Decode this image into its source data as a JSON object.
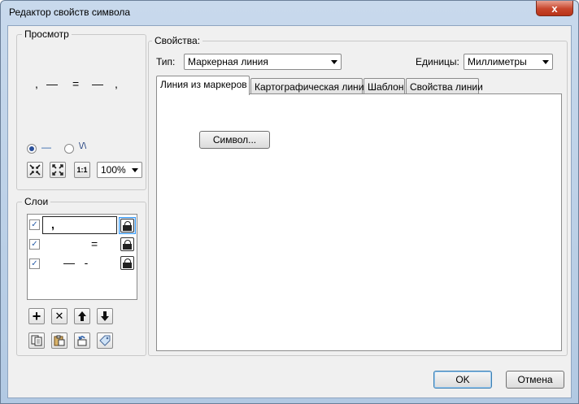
{
  "window": {
    "title": "Редактор свойств символа",
    "close_glyph": "x"
  },
  "preview": {
    "label": "Просмотр",
    "symbols": [
      ",",
      "—",
      "=",
      "—",
      ","
    ],
    "radio_line_glyph": "—",
    "radio_wave_glyph": "\\/\\",
    "zoom_value": "100%",
    "one_to_one_label": "1:1"
  },
  "layers": {
    "label": "Слои",
    "rows": [
      {
        "checked": true,
        "symbol": ",",
        "selected": true
      },
      {
        "checked": true,
        "symbol": "=",
        "selected": false
      },
      {
        "checked": true,
        "symbol": "—   -",
        "selected": false
      }
    ],
    "check_glyph": "✓"
  },
  "properties": {
    "label": "Свойства:",
    "type_label": "Тип:",
    "type_value": "Маркерная линия",
    "units_label": "Единицы:",
    "units_value": "Миллиметры",
    "tabs": [
      {
        "label": "Линия из маркеров",
        "active": true
      },
      {
        "label": "Картографическая линия",
        "active": false
      },
      {
        "label": "Шаблон",
        "active": false
      },
      {
        "label": "Свойства линии",
        "active": false
      }
    ],
    "symbol_button": "Символ..."
  },
  "footer": {
    "ok_label": "OK",
    "cancel_label": "Отмена"
  },
  "colors": {
    "accent": "#2a5ea8",
    "selected_border": "#3399ff"
  }
}
